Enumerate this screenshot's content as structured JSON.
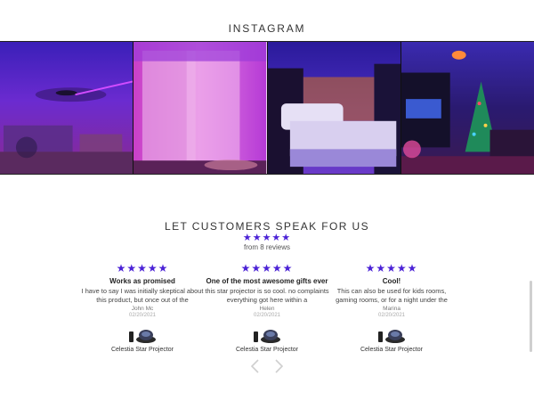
{
  "instagram": {
    "title": "INSTAGRAM",
    "photos": [
      "galaxy-bedroom-tapestry",
      "pink-curtains-room",
      "white-bed-galaxy-room",
      "christmas-tree-living-room"
    ]
  },
  "customers": {
    "title": "LET CUSTOMERS SPEAK FOR US",
    "stars": "★★★★★",
    "count": "from 8 reviews",
    "accent": "#4b22d6"
  },
  "reviews": [
    {
      "stars": "★★★★★",
      "title": "Works as promised",
      "body": "I have to say I was initially skeptical about this product, but once out of the",
      "author": "John Mc",
      "date": "02/20/2021",
      "product": "Celestia Star Projector"
    },
    {
      "stars": "★★★★★",
      "title": "One of the most awesome gifts ever",
      "body": "this star projector is so cool. no complaints everything got here within a",
      "author": "Helen",
      "date": "02/20/2021",
      "product": "Celestia Star Projector"
    },
    {
      "stars": "★★★★★",
      "title": "Cool!",
      "body": "This can also be used for kids rooms, gaming rooms, or for a night under the",
      "author": "Marina",
      "date": "02/20/2021",
      "product": "Celestia Star Projector"
    }
  ],
  "icons": {
    "prev": "chevron-left-icon",
    "next": "chevron-right-icon"
  }
}
